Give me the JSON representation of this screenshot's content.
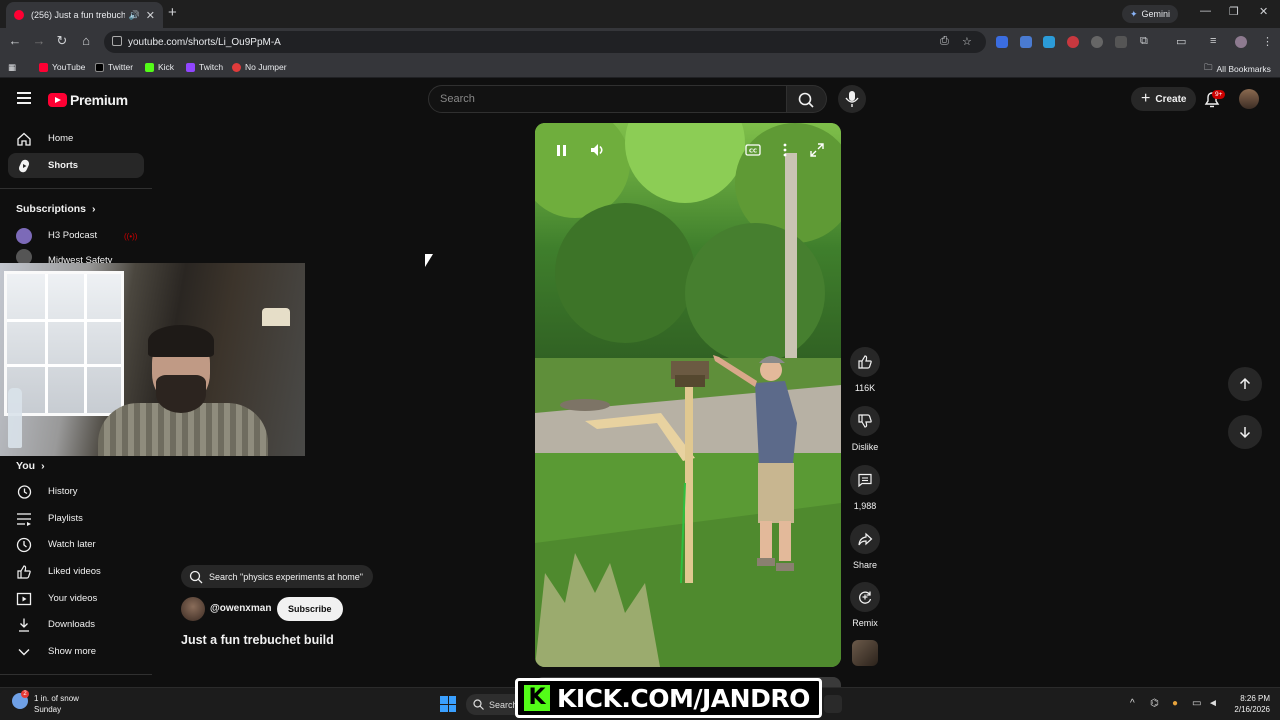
{
  "browser": {
    "tab_title": "(256) Just a fun trebuchet b",
    "url": "youtube.com/shorts/Li_Ou9PpM-A",
    "gemini_label": "Gemini",
    "bookmarks": [
      "YouTube",
      "Twitter",
      "Kick",
      "Twitch",
      "No Jumper"
    ],
    "all_bookmarks_label": "All Bookmarks"
  },
  "header": {
    "logo_text": "Premium",
    "search_placeholder": "Search",
    "create_label": "Create",
    "notification_count": "9+"
  },
  "sidebar": {
    "items": [
      {
        "label": "Home",
        "icon": "home-icon"
      },
      {
        "label": "Shorts",
        "icon": "shorts-icon",
        "active": true
      }
    ],
    "subscriptions_label": "Subscriptions",
    "subscriptions": [
      {
        "label": "H3 Podcast",
        "live": true
      },
      {
        "label": "Midwest Safety"
      }
    ],
    "you_label": "You",
    "you_items": [
      {
        "label": "History",
        "icon": "history-icon"
      },
      {
        "label": "Playlists",
        "icon": "playlists-icon"
      },
      {
        "label": "Watch later",
        "icon": "clock-icon"
      },
      {
        "label": "Liked videos",
        "icon": "thumbs-up-icon"
      },
      {
        "label": "Your videos",
        "icon": "video-icon"
      },
      {
        "label": "Downloads",
        "icon": "download-icon"
      },
      {
        "label": "Show more",
        "icon": "chevron-down-icon"
      }
    ]
  },
  "short": {
    "suggested_search": "Search \"physics experiments at home\"",
    "channel": "@owenxman",
    "subscribe_label": "Subscribe",
    "title": "Just a fun trebuchet build",
    "likes": "116K",
    "dislike_label": "Dislike",
    "comments": "1,988",
    "share_label": "Share",
    "remix_label": "Remix"
  },
  "overlay": {
    "kick_text": "KICK.COM/JANDRO"
  },
  "taskbar": {
    "weather_line1": "1 in. of snow",
    "weather_line2": "Sunday",
    "weather_badge": "2",
    "search_label": "Search",
    "time": "8:26 PM",
    "date": "2/16/2026"
  },
  "colors": {
    "yt_red": "#ff0033",
    "kick_green": "#53fc18"
  }
}
